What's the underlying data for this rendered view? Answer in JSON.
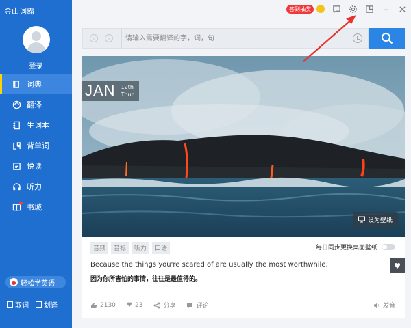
{
  "app": {
    "title": "金山词霸"
  },
  "user": {
    "login_label": "登录"
  },
  "sidebar": {
    "items": [
      {
        "label": "词典",
        "icon": "book-icon",
        "active": true
      },
      {
        "label": "翻译",
        "icon": "translate-icon",
        "active": false
      },
      {
        "label": "生词本",
        "icon": "notebook-icon",
        "active": false
      },
      {
        "label": "背单词",
        "icon": "memorize-icon",
        "active": false
      },
      {
        "label": "悦读",
        "icon": "reading-icon",
        "active": false
      },
      {
        "label": "听力",
        "icon": "headphones-icon",
        "active": false
      },
      {
        "label": "书城",
        "icon": "bookstore-icon",
        "active": false,
        "notification": true
      }
    ],
    "promo_label": "轻松学英语",
    "check_word": "取词",
    "check_select": "划译"
  },
  "topbar": {
    "badge": "答到抽奖"
  },
  "search": {
    "placeholder": "请输入需要翻译的字，词，句",
    "value": ""
  },
  "daily": {
    "month": "JAN",
    "day": "12th",
    "weekday": "Thur",
    "set_wallpaper": "设为壁纸",
    "tags": [
      "音频",
      "音标",
      "听力",
      "口语"
    ],
    "sync_label": "每日同步更换桌面壁纸",
    "sentence_en": "Because the things you're scared of are usually the most worthwhile.",
    "sentence_zh": "因为你所害怕的事情，往往是最值得的。",
    "views": "2130",
    "likes": "23",
    "share": "分享",
    "comment": "评论",
    "voice": "发音"
  },
  "colors": {
    "sidebar": "#1f6fd0",
    "accent": "#2b85e4",
    "badge": "#f0383a",
    "annotation": "#e8322f"
  }
}
